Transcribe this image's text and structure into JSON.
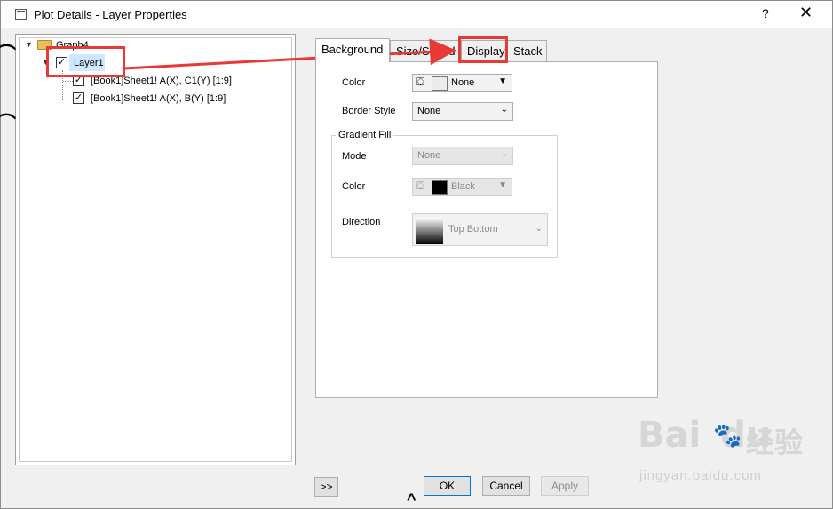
{
  "window": {
    "title": "Plot Details - Layer Properties",
    "help_label": "?",
    "close_label": "✕"
  },
  "tree": {
    "root_label": "Graph4",
    "layer_label": "Layer1",
    "plots": [
      {
        "label": "[Book1]Sheet1! A(X), C1(Y) [1:9]"
      },
      {
        "label": "[Book1]Sheet1! A(X), B(Y) [1:9]"
      }
    ]
  },
  "tabs": [
    {
      "label": "Background",
      "active": false
    },
    {
      "label": "Size/Speed",
      "active": false
    },
    {
      "label": "Display",
      "active": true
    },
    {
      "label": "Stack",
      "active": false
    }
  ],
  "background": {
    "color_label": "Color",
    "color_value": "None",
    "border_style_label": "Border Style",
    "border_style_value": "None",
    "gradient_fill": {
      "group_label": "Gradient Fill",
      "mode_label": "Mode",
      "mode_value": "None",
      "color_label": "Color",
      "color_value": "Black",
      "direction_label": "Direction",
      "direction_value": "Top Bottom"
    }
  },
  "buttons": {
    "expand_label": ">>",
    "ok_label": "OK",
    "cancel_label": "Cancel",
    "apply_label": "Apply"
  },
  "watermark": {
    "logo": "Bai",
    "logo_du": "du",
    "cn": "经验",
    "url": "jingyan.baidu.com"
  },
  "colors": {
    "annotation": "#e83a35",
    "selection": "#cde8ff",
    "swatch_none": "#ebebeb",
    "swatch_black": "#000000"
  }
}
